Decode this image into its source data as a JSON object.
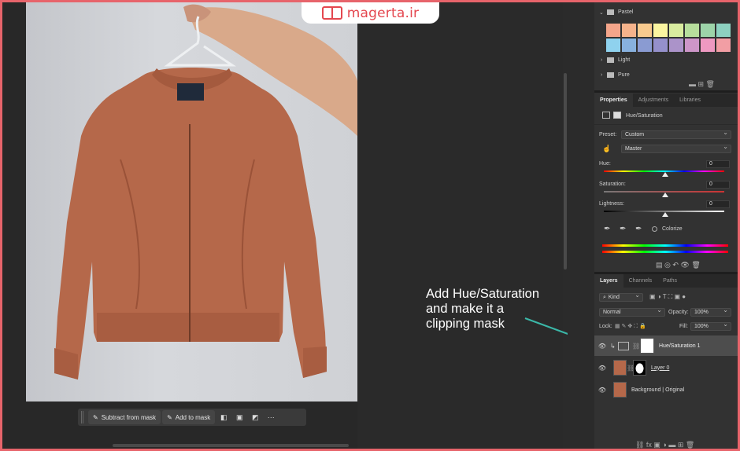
{
  "logo": {
    "text": "magerta.ir"
  },
  "context_bar": {
    "subtract_label": "Subtract from mask",
    "add_label": "Add to mask",
    "more_label": "···"
  },
  "swatches": {
    "group_pastel": "Pastel",
    "group_light": "Light",
    "group_pure": "Pure",
    "row1": [
      "#f4a58a",
      "#f6b38b",
      "#f8ca8e",
      "#fbf5a0",
      "#d9ec9f",
      "#b7de9c",
      "#9dd4a9",
      "#8dd1c0"
    ],
    "row2": [
      "#8fd2ee",
      "#88b1de",
      "#8a9bd2",
      "#9590cb",
      "#ab93c9",
      "#cd96c8",
      "#ee99c1",
      "#f29ea4"
    ]
  },
  "properties": {
    "tabs": [
      "Properties",
      "Adjustments",
      "Libraries"
    ],
    "title": "Hue/Saturation",
    "preset_label": "Preset:",
    "preset_value": "Custom",
    "channel_value": "Master",
    "hue_label": "Hue:",
    "hue_value": "0",
    "saturation_label": "Saturation:",
    "saturation_value": "0",
    "lightness_label": "Lightness:",
    "lightness_value": "0",
    "colorize_label": "Colorize"
  },
  "layers": {
    "tabs": [
      "Layers",
      "Channels",
      "Paths"
    ],
    "filter_value": "Kind",
    "blend_mode": "Normal",
    "opacity_label": "Opacity:",
    "opacity_value": "100%",
    "lock_label": "Lock:",
    "fill_label": "Fill:",
    "fill_value": "100%",
    "items": [
      {
        "name": "Hue/Saturation 1"
      },
      {
        "name": "Layer 0"
      },
      {
        "name": "Background | Original"
      }
    ]
  },
  "annotation": {
    "line1": "Add Hue/Saturation",
    "line2": "and make it a",
    "line3": "clipping mask"
  }
}
